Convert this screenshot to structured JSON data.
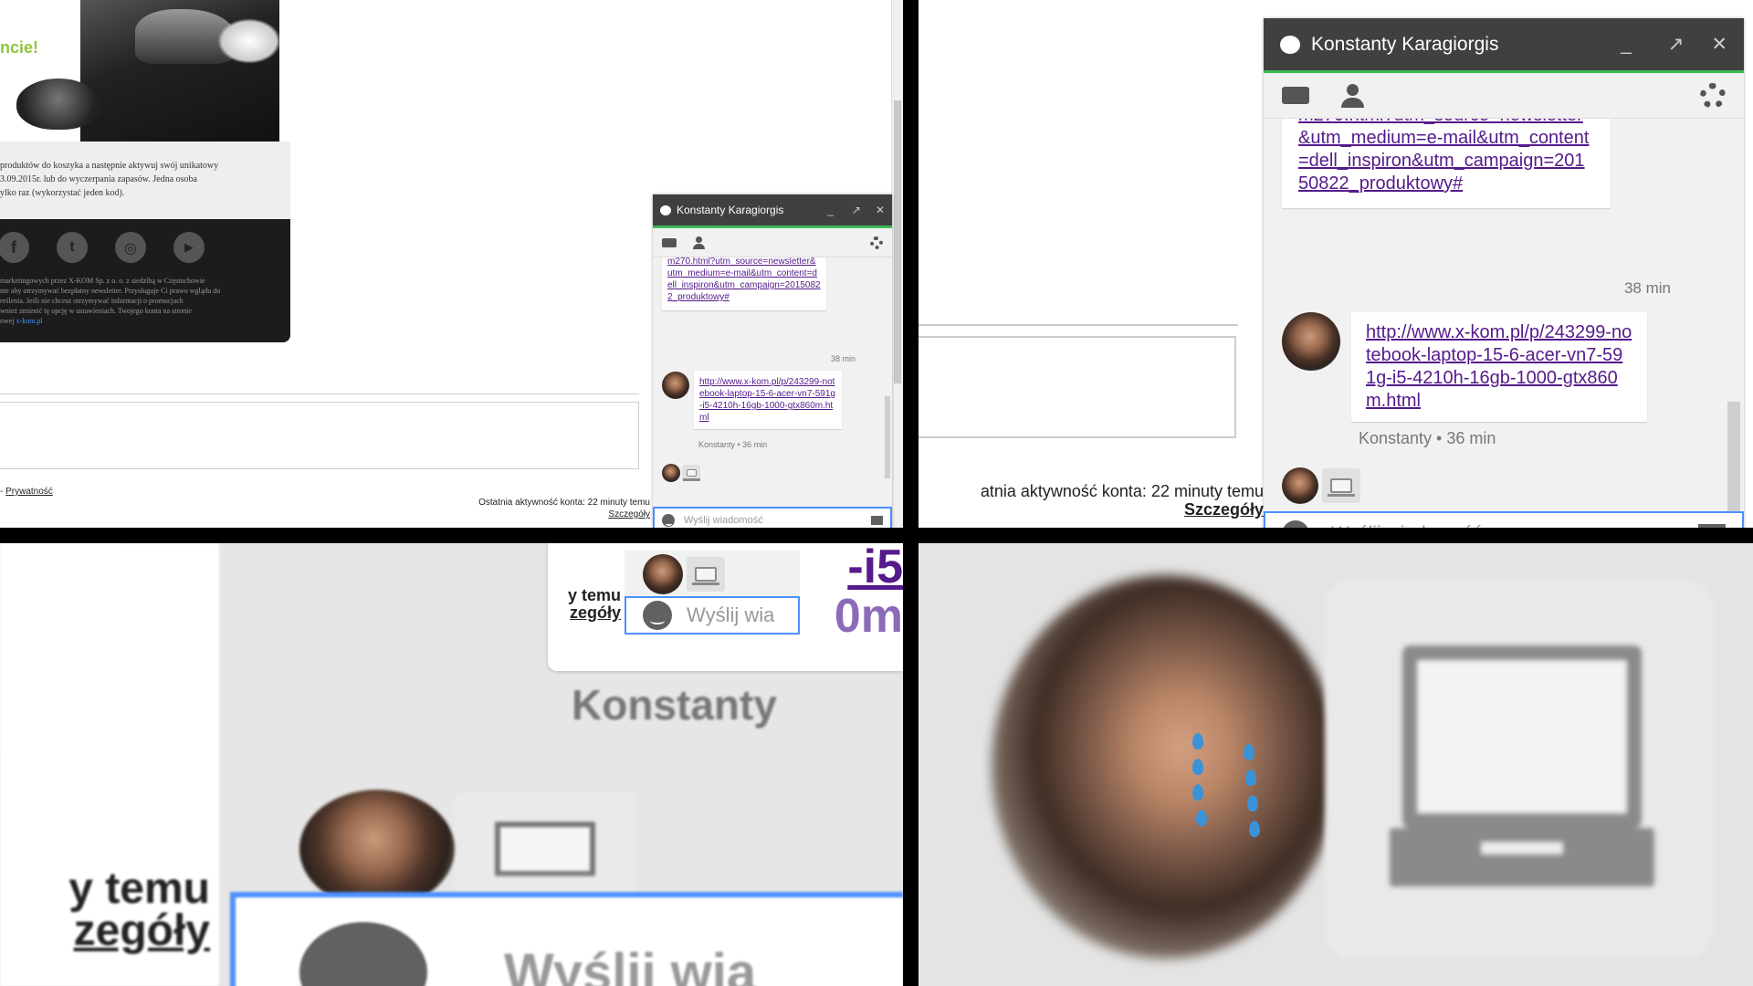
{
  "promo": {
    "headline": "ncie!",
    "text_lines": [
      "produktów do koszyka a następnie aktywuj swój unikatowy",
      "3.09.2015r. lub do wyczerpania zapasów. Jedna osoba",
      "ylko raz (wykorzystać jeden kod)."
    ],
    "social_icons": [
      "facebook-icon",
      "twitter-icon",
      "instagram-icon",
      "youtube-icon"
    ],
    "social_glyphs": [
      "f",
      "t",
      "◎",
      "▶"
    ],
    "footer_lines": [
      "marketingowych przez X-KOM Sp. z o. o. z siedzibą w Częstochowie",
      "nie aby otrzymywać bezpłatny newsletter. Przysługuje Ci prawo wglądu do",
      "reślenia. Jeśli nie chcesz otrzymywać informacji o promocjach",
      "wnież zmienić tę opcję w ustawieniach. Twojego konta na stronie",
      "owej"
    ],
    "footer_link": "x-kom.pl"
  },
  "page": {
    "privacy_prefix": "-",
    "privacy_link": "Prywatność",
    "activity": "Ostatnia aktywność konta: 22 minuty temu",
    "details_link": "Szczegóły",
    "activity_cropped": "atnia aktywność konta: 22 minuty temu"
  },
  "chat": {
    "name": "Konstanty Karagiorgis",
    "minimize": "_",
    "popout": "↗",
    "close": "✕",
    "msg1_link_cut": "m270.html?",
    "msg1_link_rest": "utm_source=newsletter&utm_medium=e-mail&utm_content=dell_inspiron&utm_campaign=20150822_produktowy#",
    "msg1_time": "38 min",
    "msg2_link": "http://www.x-kom.pl/p/243299-notebook-laptop-15-6-acer-vn7-591g-i5-4210h-16gb-1000-gtx860m.html",
    "msg2_meta": "Konstanty • 36 min",
    "input_placeholder": "Wyślij wiadomość",
    "icons": [
      "speech-bubble-icon",
      "video-camera-icon",
      "add-person-icon",
      "gear-icon",
      "emoji-icon",
      "image-icon"
    ]
  },
  "zoom3": {
    "link_frag": "-i5",
    "link_frag2": "0m",
    "activity_frag": "y temu",
    "details_frag": "zegóły",
    "sender": "Konstanty",
    "input_frag": "Wyślij wia",
    "big_activity": "y temu",
    "big_details": "zegóły",
    "big_input": "Wyślij wia"
  },
  "colors": {
    "chat_header": "#404040",
    "accent_green": "#3cba54",
    "input_border": "#4d90fe",
    "link": "#1a0dab",
    "visited_link": "#551a8b",
    "promo_green": "#8cc63f"
  }
}
